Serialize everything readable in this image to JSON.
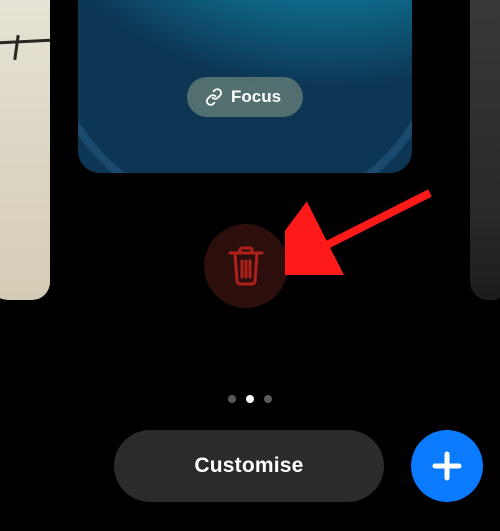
{
  "focus": {
    "label": "Focus"
  },
  "actions": {
    "customise_label": "Customise"
  },
  "page_indicator": {
    "count": 3,
    "current": 2
  },
  "colors": {
    "accent_blue": "#0a7aff",
    "trash_red": "#b0201a",
    "dark_button": "#2b2b2c"
  }
}
